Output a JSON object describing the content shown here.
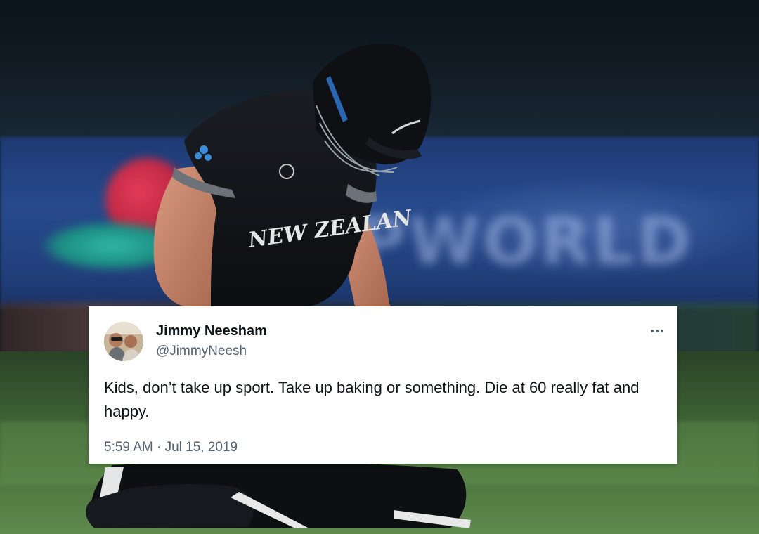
{
  "tweet": {
    "display_name": "Jimmy Neesham",
    "handle": "@JimmyNeesh",
    "text": "Kids, don’t take up sport. Take up baking or something. Die at 60 really fat and happy.",
    "timestamp": "5:59 AM · Jul 15, 2019"
  },
  "background": {
    "board_text": "PWORLD",
    "shirt_text": "NEW ZEALAN",
    "colors": {
      "board_blue": "#274a8c",
      "shirt_black": "#121417",
      "field_green": "#4f7a40"
    }
  },
  "icons": {
    "more": "more-horizontal-icon"
  }
}
